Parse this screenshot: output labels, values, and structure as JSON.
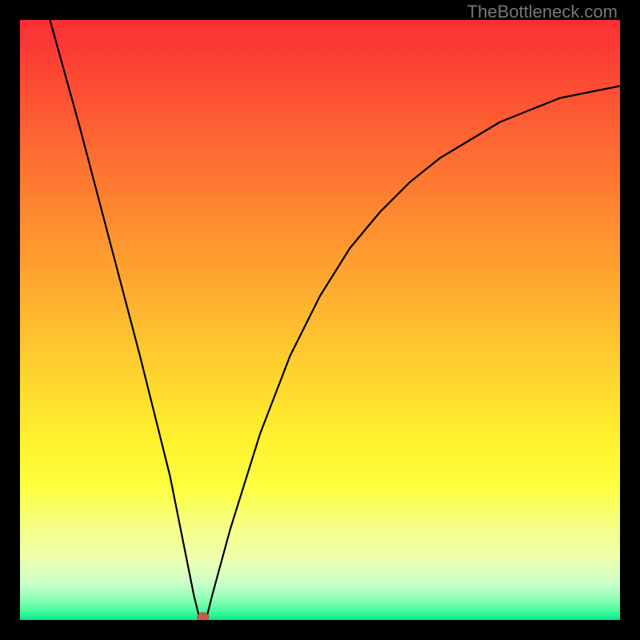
{
  "watermark": "TheBottleneck.com",
  "chart_data": {
    "type": "line",
    "title": "",
    "xlabel": "",
    "ylabel": "",
    "xlim": [
      0,
      100
    ],
    "ylim": [
      0,
      100
    ],
    "grid": false,
    "legend": false,
    "series": [
      {
        "name": "bottleneck-curve",
        "x": [
          5,
          10,
          15,
          20,
          25,
          27,
          29,
          30,
          31,
          32,
          35,
          40,
          45,
          50,
          55,
          60,
          65,
          70,
          75,
          80,
          85,
          90,
          95,
          100
        ],
        "y": [
          100,
          82,
          63,
          44,
          24,
          14,
          4,
          0,
          0,
          4,
          15,
          31,
          44,
          54,
          62,
          68,
          73,
          77,
          80,
          83,
          85,
          87,
          88,
          89
        ]
      }
    ],
    "marker": {
      "name": "optimal-point",
      "x": 30.5,
      "y": 0.5,
      "color": "#cc5a4a"
    },
    "background_gradient": {
      "stops": [
        {
          "offset": 0.0,
          "color": "#fc2e34"
        },
        {
          "offset": 0.1,
          "color": "#fd4a33"
        },
        {
          "offset": 0.2,
          "color": "#fd6632"
        },
        {
          "offset": 0.3,
          "color": "#fd8231"
        },
        {
          "offset": 0.4,
          "color": "#fe9e30"
        },
        {
          "offset": 0.5,
          "color": "#feba2f"
        },
        {
          "offset": 0.6,
          "color": "#fed62e"
        },
        {
          "offset": 0.7,
          "color": "#fef22d"
        },
        {
          "offset": 0.78,
          "color": "#feff40"
        },
        {
          "offset": 0.84,
          "color": "#f6ff80"
        },
        {
          "offset": 0.9,
          "color": "#ecffb0"
        },
        {
          "offset": 0.94,
          "color": "#c8ffc8"
        },
        {
          "offset": 0.97,
          "color": "#80ffb0"
        },
        {
          "offset": 0.99,
          "color": "#30f89a"
        },
        {
          "offset": 1.0,
          "color": "#00e888"
        }
      ]
    }
  }
}
